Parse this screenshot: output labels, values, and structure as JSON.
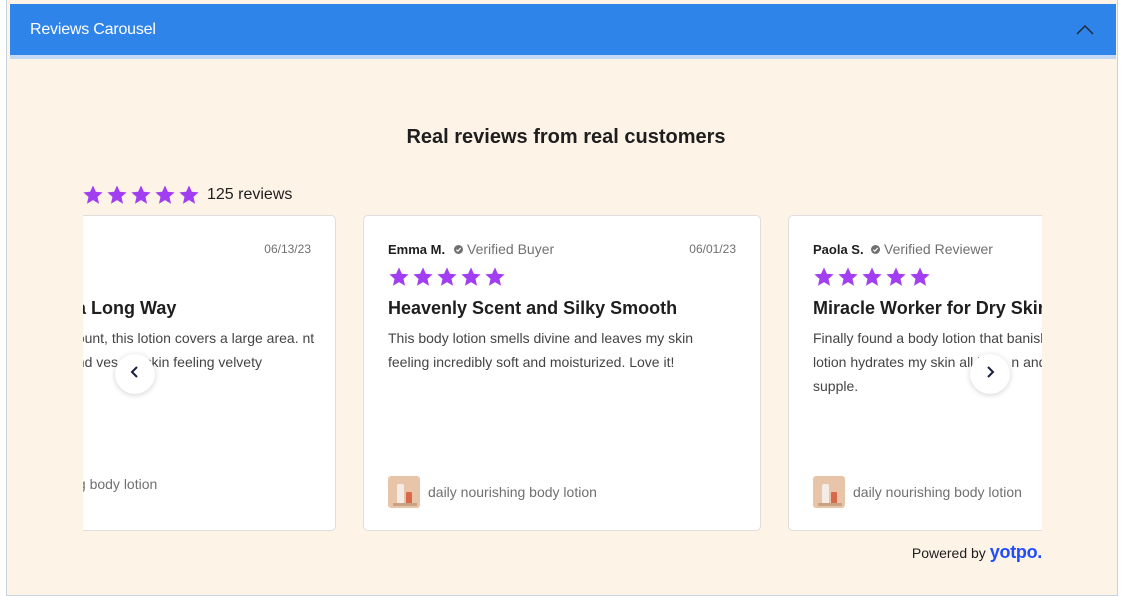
{
  "header": {
    "title": "Reviews Carousel"
  },
  "section": {
    "title": "Real reviews from real customers"
  },
  "summary": {
    "rating": 5,
    "review_count": "125 reviews"
  },
  "colors": {
    "star": "#a13ef2",
    "header": "#2f84ea",
    "panel": "#fdf3e7",
    "brand": "#1f4cff"
  },
  "reviews": [
    {
      "name": "",
      "badge": "",
      "date": "06/13/23",
      "rating": 5,
      "title": "a Long Way",
      "body": "nount, this lotion covers a large area. nt and ves my skin feeling velvety",
      "product": "ing body lotion"
    },
    {
      "name": "Emma M.",
      "badge": "Verified Buyer",
      "date": "06/01/23",
      "rating": 5,
      "title": "Heavenly Scent and Silky Smooth",
      "body": "This body lotion smells divine and leaves my skin feeling incredibly soft and moisturized. Love it!",
      "product": "daily nourishing body lotion"
    },
    {
      "name": "Paola S.",
      "badge": "Verified Reviewer",
      "date": "",
      "rating": 5,
      "title": "Miracle Worker for Dry Skin",
      "body": "Finally found a body lotion that banish lotion hydrates my skin all long, n and supple.",
      "product": "daily nourishing body lotion"
    }
  ],
  "footer": {
    "powered_by": "Powered by",
    "brand": "yotpo."
  }
}
